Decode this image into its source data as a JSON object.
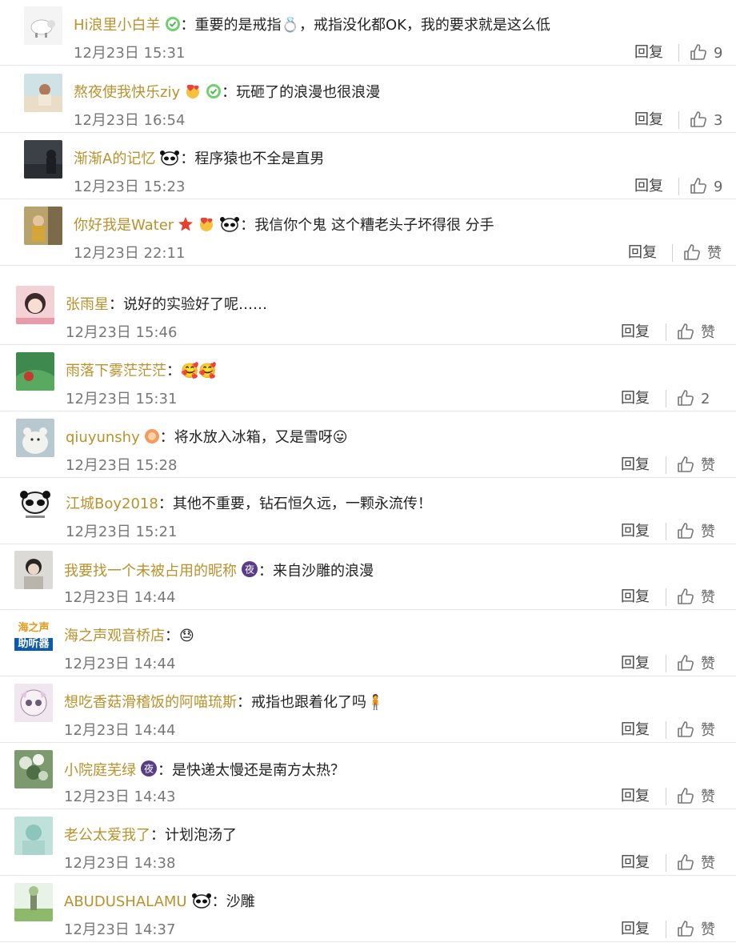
{
  "comments": [
    {
      "user": "Hi浪里小白羊",
      "colon": "：",
      "text": "重要的是戒指💍，戒指没化都OK，我的要求就是这么低",
      "time": "12月23日 15:31",
      "reply": "回复",
      "like": "9",
      "badges": [
        "verified"
      ],
      "avatar": "sheep"
    },
    {
      "user": "熬夜使我快乐ziy",
      "colon": "：",
      "text": "玩砸了的浪漫也很浪漫",
      "time": "12月23日 16:54",
      "reply": "回复",
      "like": "3",
      "badges": [
        "heart-face",
        "verified"
      ],
      "avatar": "girl-cloud"
    },
    {
      "user": "渐渐A的记忆",
      "colon": "：",
      "text": "程序猿也不全是直男",
      "time": "12月23日 15:23",
      "reply": "回复",
      "like": "9",
      "badges": [
        "panda"
      ],
      "avatar": "dark"
    },
    {
      "user": "你好我是Water",
      "colon": "：",
      "text": "我信你个鬼 这个糟老头子坏得很 分手",
      "time": "12月23日 22:11",
      "reply": "回复",
      "like": "赞",
      "badges": [
        "star",
        "heart-face",
        "panda"
      ],
      "avatar": "yellow-girl"
    },
    {
      "user": "张雨星",
      "colon": "：",
      "text": "说好的实验好了呢……",
      "time": "12月23日 15:46",
      "reply": "回复",
      "like": "赞",
      "badges": [],
      "avatar": "pink-girl"
    },
    {
      "user": "雨落下雾茫茫茫",
      "colon": "：",
      "text": "🥰🥰",
      "time": "12月23日 15:31",
      "reply": "回复",
      "like": "2",
      "badges": [],
      "avatar": "green-red"
    },
    {
      "user": "qiuyunshy",
      "colon": "：",
      "text": "将水放入冰箱，又是雪呀😛",
      "time": "12月23日 15:28",
      "reply": "回复",
      "like": "赞",
      "badges": [
        "orange"
      ],
      "avatar": "bear"
    },
    {
      "user": "江城Boy2018",
      "colon": "：",
      "text": "其他不重要，钻石恒久远，一颗永流传！",
      "time": "12月23日 15:21",
      "reply": "回复",
      "like": "赞",
      "badges": [],
      "avatar": "panda-face"
    },
    {
      "user": "我要找一个未被占用的昵称",
      "colon": "：",
      "text": "来自沙雕的浪漫",
      "time": "12月23日 14:44",
      "reply": "回复",
      "like": "赞",
      "badges": [
        "night"
      ],
      "avatar": "girl-gray"
    },
    {
      "user": "海之声观音桥店",
      "colon": "：",
      "text": "😓",
      "time": "12月23日 14:44",
      "reply": "回复",
      "like": "赞",
      "badges": [],
      "avatar": "hearing"
    },
    {
      "user": "想吃香菇滑稽饭的阿喵琉斯",
      "colon": "：",
      "text": "戒指也跟着化了吗🧍",
      "time": "12月23日 14:44",
      "reply": "回复",
      "like": "赞",
      "badges": [],
      "avatar": "anime"
    },
    {
      "user": "小院庭芜绿",
      "colon": "：",
      "text": "是快递太慢还是南方太热？",
      "time": "12月23日 14:43",
      "reply": "回复",
      "like": "赞",
      "badges": [
        "night"
      ],
      "avatar": "plant"
    },
    {
      "user": "老公太爱我了",
      "colon": "：",
      "text": "计划泡汤了",
      "time": "12月23日 14:38",
      "reply": "回复",
      "like": "赞",
      "badges": [],
      "avatar": "teal"
    },
    {
      "user": "ABUDUSHALAMU",
      "colon": "：",
      "text": "沙雕",
      "time": "12月23日 14:37",
      "reply": "回复",
      "like": "赞",
      "badges": [
        "panda"
      ],
      "avatar": "field"
    }
  ],
  "hearing_avatar_text": {
    "line1": "海之声",
    "line2": "助听器"
  }
}
